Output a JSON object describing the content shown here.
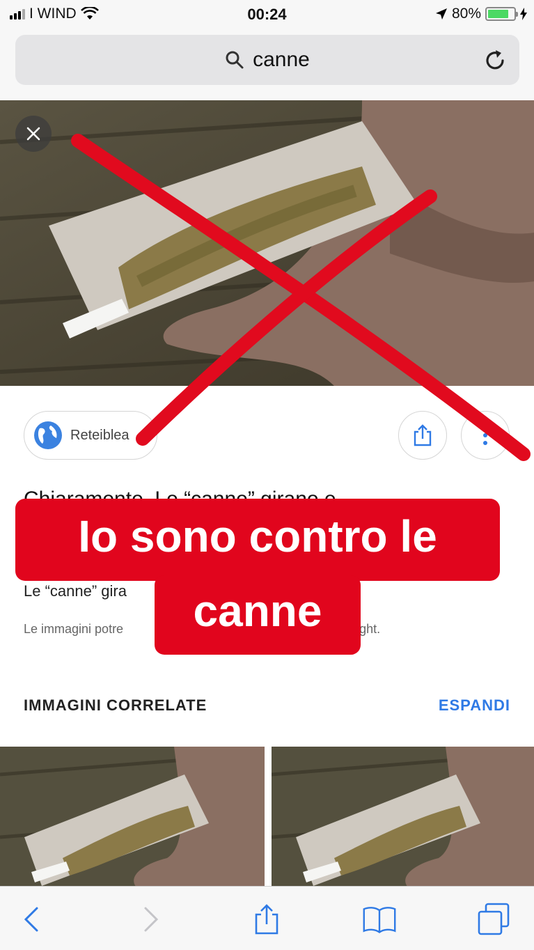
{
  "status": {
    "carrier": "I WIND",
    "time": "00:24",
    "battery": "80%",
    "battery_level": 0.8
  },
  "search": {
    "query": "canne"
  },
  "source": {
    "label": "Reteiblea"
  },
  "result": {
    "title": "Chiaramente. Le “canne” girano e",
    "subtitle": "Le “canne” gira",
    "disclaimer_left": "Le immagini potre",
    "disclaimer_right": "opyright."
  },
  "sticker": {
    "line1": "Io sono contro le",
    "line2": "canne"
  },
  "related": {
    "title": "IMMAGINI CORRELATE",
    "expand": "ESPANDI"
  },
  "colors": {
    "accent": "#2f7ae5",
    "sticker_red": "#e1051d",
    "cross_red": "#e10a1e"
  },
  "icons": {
    "search": "search-icon",
    "reload": "reload-icon",
    "close": "close-icon",
    "globe": "globe-icon",
    "share": "share-icon",
    "more": "more-icon",
    "back": "chevron-left-icon",
    "forward": "chevron-right-icon",
    "bookmarks": "book-icon",
    "tabs": "tabs-icon"
  }
}
